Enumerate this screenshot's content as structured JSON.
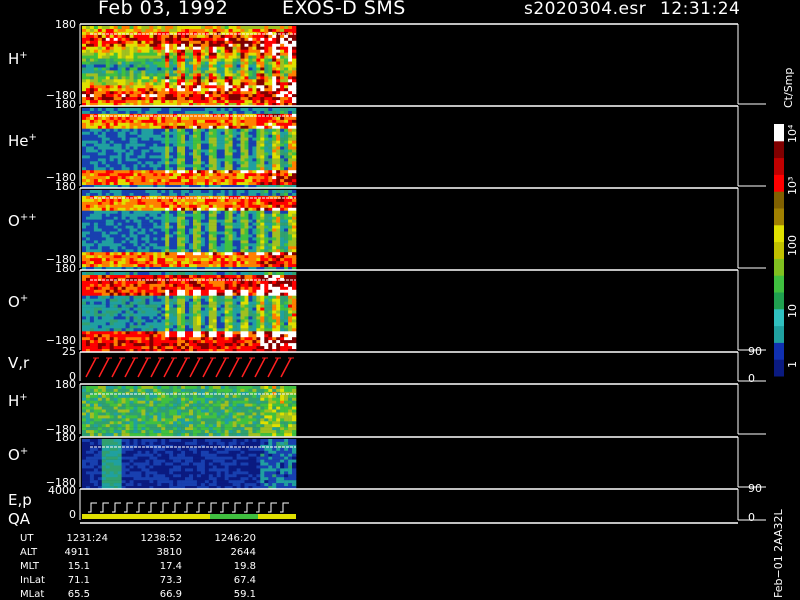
{
  "header": {
    "date": "Feb 03, 1992",
    "instrument": "EXOS-D SMS",
    "file": "s2020304.esr",
    "time": "12:31:24"
  },
  "colors": {
    "background": "#000000",
    "low": "#0a1a80",
    "mid": "#20a0a0",
    "green": "#40c040",
    "yellow": "#e0e000",
    "orange": "#ff8000",
    "red": "#ff0000",
    "darkred": "#800000",
    "white": "#ffffff"
  },
  "panels": [
    {
      "label": "H",
      "sup": "+",
      "ytop": "180",
      "ybot": "−180"
    },
    {
      "label": "He",
      "sup": "+",
      "ytop": "180",
      "ybot": "−180"
    },
    {
      "label": "O",
      "sup": "++",
      "ytop": "180",
      "ybot": "−180"
    },
    {
      "label": "O",
      "sup": "+",
      "ytop": "180",
      "ybot": "−180"
    },
    {
      "label": "V,r",
      "sup": "",
      "ytop": "25",
      "ybot": "0",
      "rtop": "90",
      "rbot": "0"
    },
    {
      "label": "H",
      "sup": "+",
      "ytop": "180",
      "ybot": "−180"
    },
    {
      "label": "O",
      "sup": "+",
      "ytop": "180",
      "ybot": "−180"
    },
    {
      "label": "E,p",
      "sub_label": "QA",
      "ytop": "4000",
      "ybot": "0",
      "rtop": "90",
      "rbot": "0"
    }
  ],
  "colorbar": {
    "unit": "Ct/Smp",
    "ticks": [
      "1",
      "10",
      "100",
      "10³",
      "10⁴"
    ]
  },
  "table": {
    "rows": [
      "UT",
      "ALT",
      "MLT",
      "InLat",
      "MLat"
    ],
    "columns": [
      [
        "1231:24",
        "4911",
        "15.1",
        "71.1",
        "65.5"
      ],
      [
        "1238:52",
        "3810",
        "17.4",
        "73.3",
        "66.9"
      ],
      [
        "1246:20",
        "2644",
        "19.8",
        "67.4",
        "59.1"
      ]
    ]
  },
  "footer_vertical": "Feb−01  2AA32L",
  "chart_data": {
    "type": "heatmap",
    "title": "Feb 03, 1992   EXOS-D SMS",
    "x_tick_labels": [
      "1231:24",
      "1238:52",
      "1246:20"
    ],
    "pitch_angle_range": [
      -180,
      180
    ],
    "colorbar_scale": "log",
    "colorbar_range": [
      1,
      10000
    ],
    "colorbar_unit": "Ct/Smp",
    "panels": [
      "H+",
      "He+",
      "O++",
      "O+",
      "V,r",
      "H+",
      "O+",
      "E,p"
    ]
  }
}
